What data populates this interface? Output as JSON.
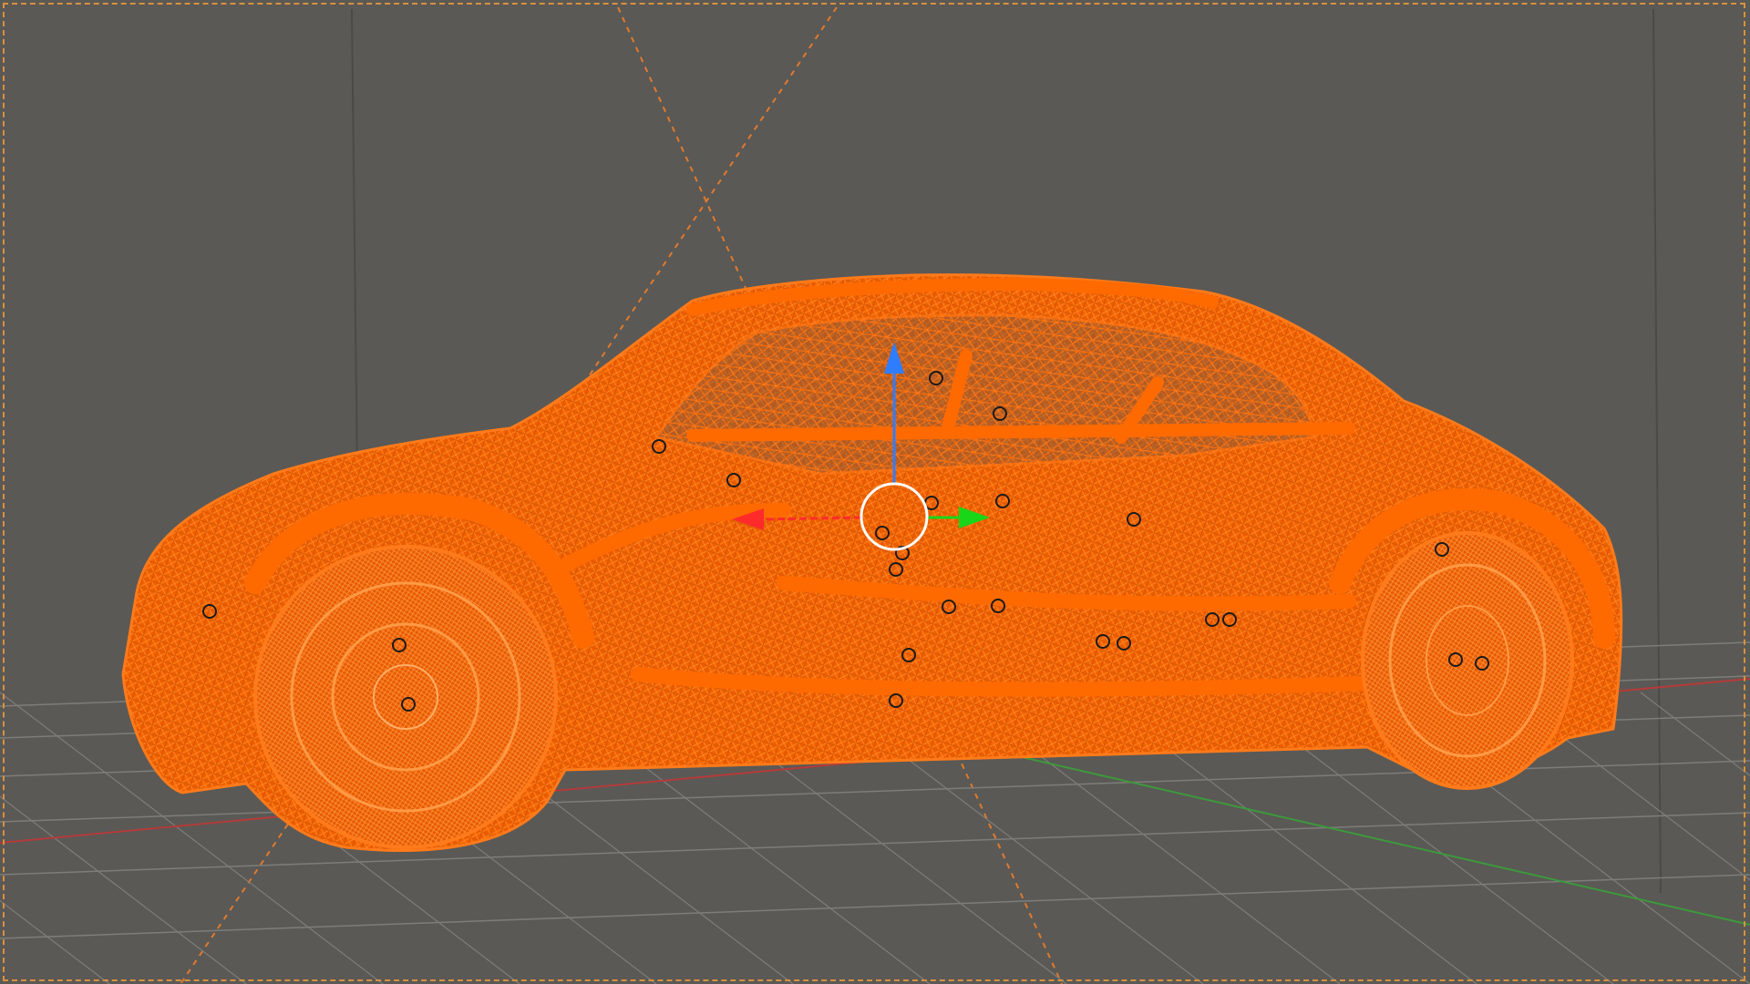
{
  "viewport": {
    "mode": "wireframe",
    "selected_object": "car",
    "colors": {
      "background": "#5a5955",
      "grid": "#7d7d7a",
      "x_axis": "#b23b3b",
      "y_axis": "#3c9a3c",
      "selection": "#ff6a00",
      "selection_dark": "#e85a00",
      "camera_guides": "#e07a2e",
      "frame_border": "#d7923e",
      "gizmo_x": "#ff2b2b",
      "gizmo_y": "#19d619",
      "gizmo_z": "#2f7dff",
      "gizmo_center": "#ffffff"
    }
  },
  "gizmo": {
    "type": "translate",
    "axes": [
      "x",
      "y",
      "z"
    ],
    "icons": {
      "x": "arrow-left-red",
      "y": "arrow-right-green",
      "z": "arrow-up-blue",
      "center": "circle-white"
    }
  },
  "markers": {
    "count": 24,
    "icon": "circle-outline"
  }
}
